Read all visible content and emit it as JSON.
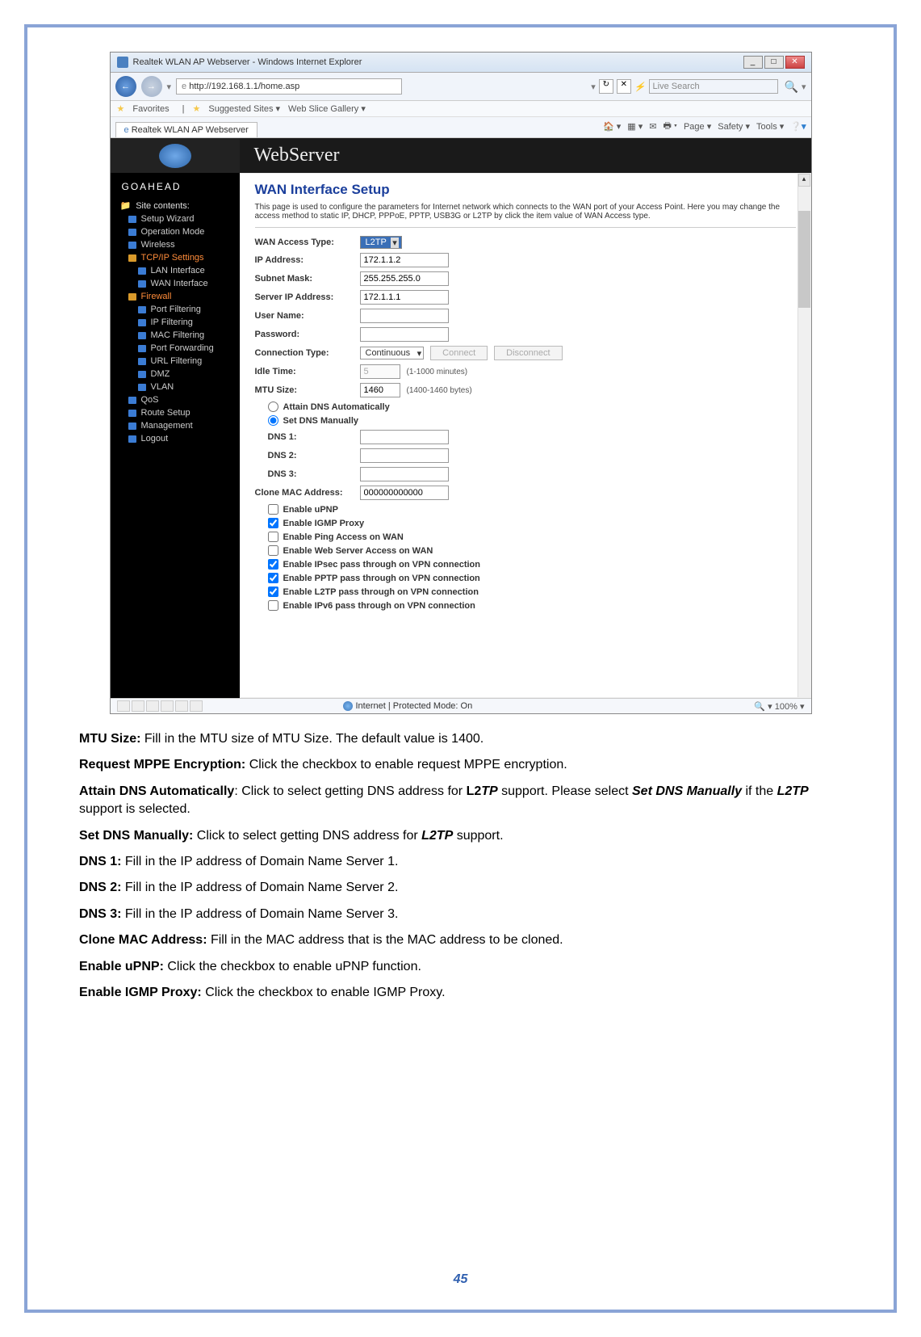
{
  "window": {
    "title": "Realtek WLAN AP Webserver - Windows Internet Explorer",
    "address": "http://192.168.1.1/home.asp",
    "search_placeholder": "Live Search",
    "favorites_label": "Favorites",
    "fav_links": [
      "Suggested Sites ▾",
      "Web Slice Gallery ▾"
    ],
    "tab_label": "Realtek WLAN AP Webserver",
    "ie_tools": [
      "Page ▾",
      "Safety ▾",
      "Tools ▾"
    ],
    "status_text": "Internet | Protected Mode: On",
    "zoom": "100%"
  },
  "webserver": {
    "banner_title": "WebServer",
    "goahead": "GOAHEAD",
    "sidebar_root": "Site contents:",
    "sidebar": {
      "setup_wizard": "Setup Wizard",
      "operation_mode": "Operation Mode",
      "wireless": "Wireless",
      "tcpip": "TCP/IP Settings",
      "lan": "LAN Interface",
      "wan": "WAN Interface",
      "firewall": "Firewall",
      "port_filtering": "Port Filtering",
      "ip_filtering": "IP Filtering",
      "mac_filtering": "MAC Filtering",
      "port_forwarding": "Port Forwarding",
      "url_filtering": "URL Filtering",
      "dmz": "DMZ",
      "vlan": "VLAN",
      "qos": "QoS",
      "route_setup": "Route Setup",
      "management": "Management",
      "logout": "Logout"
    },
    "content": {
      "title": "WAN Interface Setup",
      "desc": "This page is used to configure the parameters for Internet network which connects to the WAN port of your Access Point. Here you may change the access method to static IP, DHCP, PPPoE, PPTP, USB3G or L2TP by click the item value of WAN Access type.",
      "labels": {
        "wan_access_type": "WAN Access Type:",
        "ip_address": "IP Address:",
        "subnet_mask": "Subnet Mask:",
        "server_ip": "Server IP Address:",
        "user_name": "User Name:",
        "password": "Password:",
        "connection_type": "Connection Type:",
        "idle_time": "Idle Time:",
        "mtu_size": "MTU Size:",
        "attain_dns": "Attain DNS Automatically",
        "set_dns": "Set DNS Manually",
        "dns1": "DNS 1:",
        "dns2": "DNS 2:",
        "dns3": "DNS 3:",
        "clone_mac": "Clone MAC Address:",
        "enable_upnp": "Enable uPNP",
        "enable_igmp": "Enable IGMP Proxy",
        "enable_ping": "Enable Ping Access on WAN",
        "enable_web": "Enable Web Server Access on WAN",
        "enable_ipsec": "Enable IPsec pass through on VPN connection",
        "enable_pptp": "Enable PPTP pass through on VPN connection",
        "enable_l2tp": "Enable L2TP pass through on VPN connection",
        "enable_ipv6": "Enable IPv6 pass through on VPN connection"
      },
      "values": {
        "wan_access_type": "L2TP",
        "ip_address": "172.1.1.2",
        "subnet_mask": "255.255.255.0",
        "server_ip": "172.1.1.1",
        "user_name": "",
        "password": "",
        "connection_type": "Continuous",
        "idle_time": "5",
        "mtu_size": "1460",
        "dns1": "",
        "dns2": "",
        "dns3": "",
        "clone_mac": "000000000000"
      },
      "buttons": {
        "connect": "Connect",
        "disconnect": "Disconnect"
      },
      "hints": {
        "idle_time": "(1-1000 minutes)",
        "mtu_size": "(1400-1460 bytes)"
      }
    }
  },
  "doc_paragraphs": {
    "mtu_label": "MTU Size:",
    "mtu_text": " Fill in the MTU size of MTU Size. The default value is 1400.",
    "mppe_label": "Request MPPE Encryption:",
    "mppe_text": " Click the checkbox to enable request MPPE encryption.",
    "attain_label": "Attain DNS Automatically",
    "attain_text1": ": Click to select getting DNS address for ",
    "attain_l2tp": "L2TP",
    "attain_text2": " support. Please select ",
    "attain_setdns": "Set DNS Manually",
    "attain_text3": " if the ",
    "attain_l2tp2": "L2TP",
    "attain_text4": " support is selected.",
    "setdns_label": "Set DNS Manually:",
    "setdns_text1": " Click to select getting DNS address for ",
    "setdns_l2tp": "L2TP",
    "setdns_text2": " support.",
    "dns1_label": "DNS 1:",
    "dns1_text": " Fill in the IP address of Domain Name Server 1.",
    "dns2_label": "DNS 2:",
    "dns2_text": " Fill in the IP address of Domain Name Server 2.",
    "dns3_label": "DNS 3:",
    "dns3_text": " Fill in the IP address of Domain Name Server 3.",
    "clone_label": "Clone MAC Address:",
    "clone_text": " Fill in the MAC address that is the MAC address to be cloned.",
    "upnp_label": "Enable uPNP:",
    "upnp_text": " Click the checkbox to enable uPNP function.",
    "igmp_label": "Enable IGMP Proxy:",
    "igmp_text": " Click the checkbox to enable IGMP Proxy."
  },
  "page_number": "45"
}
